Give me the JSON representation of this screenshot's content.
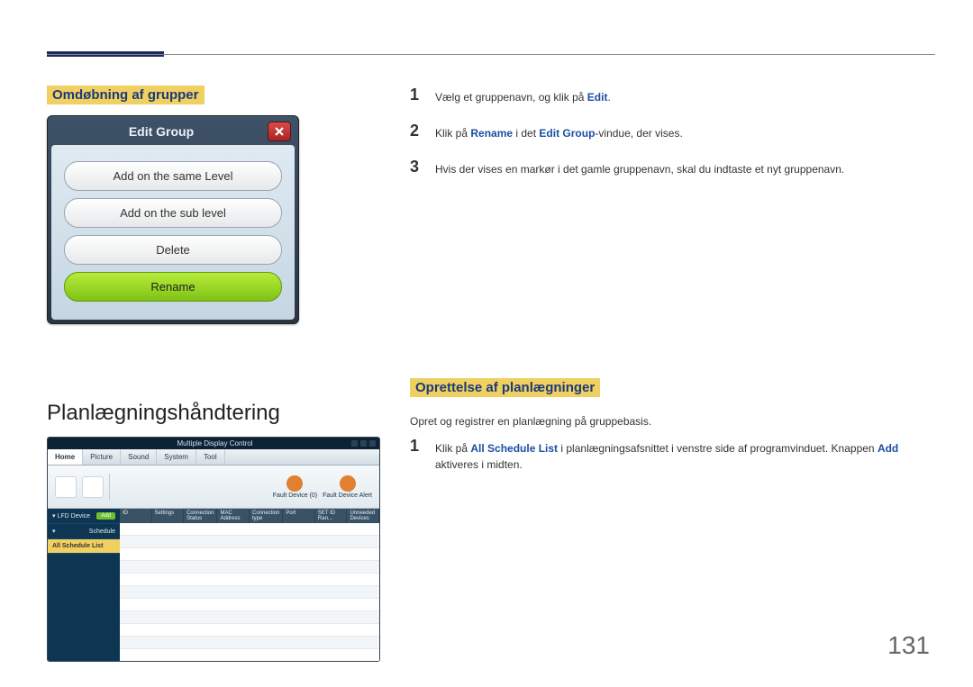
{
  "page_number": "131",
  "sections": {
    "rename_heading": "Omdøbning af grupper",
    "schedule_mgmt_heading": "Planlægningshåndtering",
    "create_sched_heading": "Oprettelse af planlægninger",
    "create_sched_intro": "Opret og registrer en planlægning på gruppebasis."
  },
  "dialog": {
    "title": "Edit Group",
    "btn_same_level": "Add on the same Level",
    "btn_sub_level": "Add on the sub level",
    "btn_delete": "Delete",
    "btn_rename": "Rename"
  },
  "steps_rename": {
    "s1_a": "Vælg et gruppenavn, og klik på ",
    "s1_kw": "Edit",
    "s2_a": "Klik på ",
    "s2_kw1": "Rename",
    "s2_b": " i det ",
    "s2_kw2": "Edit Group",
    "s2_c": "-vindue, der vises.",
    "s3": "Hvis der vises en markør i det gamle gruppenavn, skal du indtaste et nyt gruppenavn."
  },
  "steps_create": {
    "s1_a": "Klik på ",
    "s1_kw1": "All Schedule List",
    "s1_b": " i planlægningsafsnittet i venstre side af programvinduet. Knappen ",
    "s1_kw2": "Add",
    "s1_c": " aktiveres i midten."
  },
  "app": {
    "title": "Multiple Display Control",
    "tabs": [
      "Home",
      "Picture",
      "Sound",
      "System",
      "Tool"
    ],
    "toolbar_links": [
      "Fault Device (0)",
      "Fault Device Alert"
    ],
    "side": {
      "lfd": "LFD Device",
      "add": "Add",
      "schedule": "Schedule",
      "all_list": "All Schedule List"
    },
    "columns": [
      "ID",
      "Settings",
      "Connection Status",
      "MAC Address",
      "Connection type",
      "Port",
      "SET ID Ran...",
      "Unneeded Devices"
    ]
  }
}
